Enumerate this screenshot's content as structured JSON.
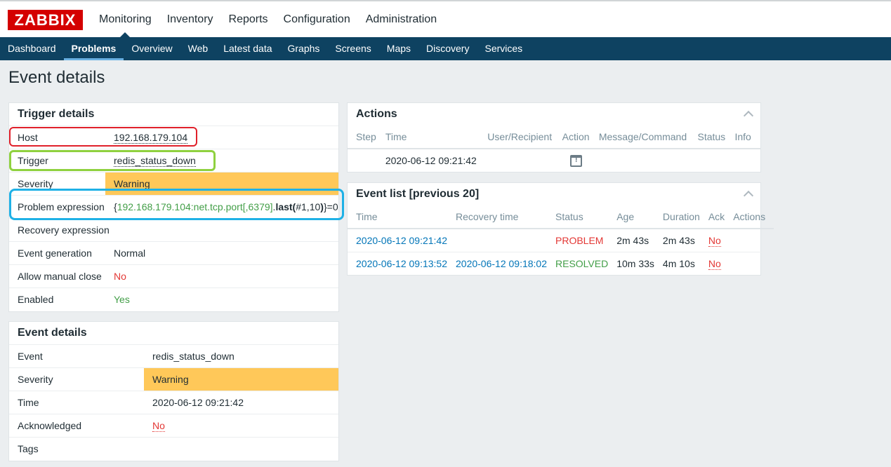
{
  "logo": "ZABBIX",
  "main_menu": [
    "Monitoring",
    "Inventory",
    "Reports",
    "Configuration",
    "Administration"
  ],
  "sub_menu": [
    "Dashboard",
    "Problems",
    "Overview",
    "Web",
    "Latest data",
    "Graphs",
    "Screens",
    "Maps",
    "Discovery",
    "Services"
  ],
  "page_title": "Event details",
  "trigger_details": {
    "title": "Trigger details",
    "host_label": "Host",
    "host_value": "192.168.179.104",
    "trigger_label": "Trigger",
    "trigger_value": "redis_status_down",
    "severity_label": "Severity",
    "severity_value": "Warning",
    "problem_expr_label": "Problem expression",
    "expr_open": "{",
    "expr_item": "192.168.179.104:net.tcp.port[,6379]",
    "expr_dot": ".",
    "expr_func": "last(",
    "expr_args": "#1,10",
    "expr_close_paren": ")",
    "expr_close": "}",
    "expr_tail": "=0",
    "recovery_expr_label": "Recovery expression",
    "recovery_expr_value": "",
    "event_gen_label": "Event generation",
    "event_gen_value": "Normal",
    "manual_close_label": "Allow manual close",
    "manual_close_value": "No",
    "enabled_label": "Enabled",
    "enabled_value": "Yes"
  },
  "event_details": {
    "title": "Event details",
    "event_label": "Event",
    "event_value": "redis_status_down",
    "severity_label": "Severity",
    "severity_value": "Warning",
    "time_label": "Time",
    "time_value": "2020-06-12 09:21:42",
    "ack_label": "Acknowledged",
    "ack_value": "No",
    "tags_label": "Tags",
    "tags_value": ""
  },
  "actions": {
    "title": "Actions",
    "columns": [
      "Step",
      "Time",
      "User/Recipient",
      "Action",
      "Message/Command",
      "Status",
      "Info"
    ],
    "rows": [
      {
        "step": "",
        "time": "2020-06-12 09:21:42",
        "user": "",
        "action_icon": "calendar-alert-icon",
        "message": "",
        "status": "",
        "info": ""
      }
    ]
  },
  "event_list": {
    "title": "Event list [previous 20]",
    "columns": [
      "Time",
      "Recovery time",
      "Status",
      "Age",
      "Duration",
      "Ack",
      "Actions"
    ],
    "rows": [
      {
        "time": "2020-06-12 09:21:42",
        "recovery": "",
        "status": "PROBLEM",
        "age": "2m 43s",
        "duration": "2m 43s",
        "ack": "No",
        "actions": ""
      },
      {
        "time": "2020-06-12 09:13:52",
        "recovery": "2020-06-12 09:18:02",
        "status": "RESOLVED",
        "age": "10m 33s",
        "duration": "4m 10s",
        "ack": "No",
        "actions": ""
      }
    ]
  },
  "colors": {
    "warning": "#ffc859",
    "problem": "#e33734",
    "resolved": "#429e47",
    "nav": "#0e4261",
    "logo": "#d40000"
  }
}
